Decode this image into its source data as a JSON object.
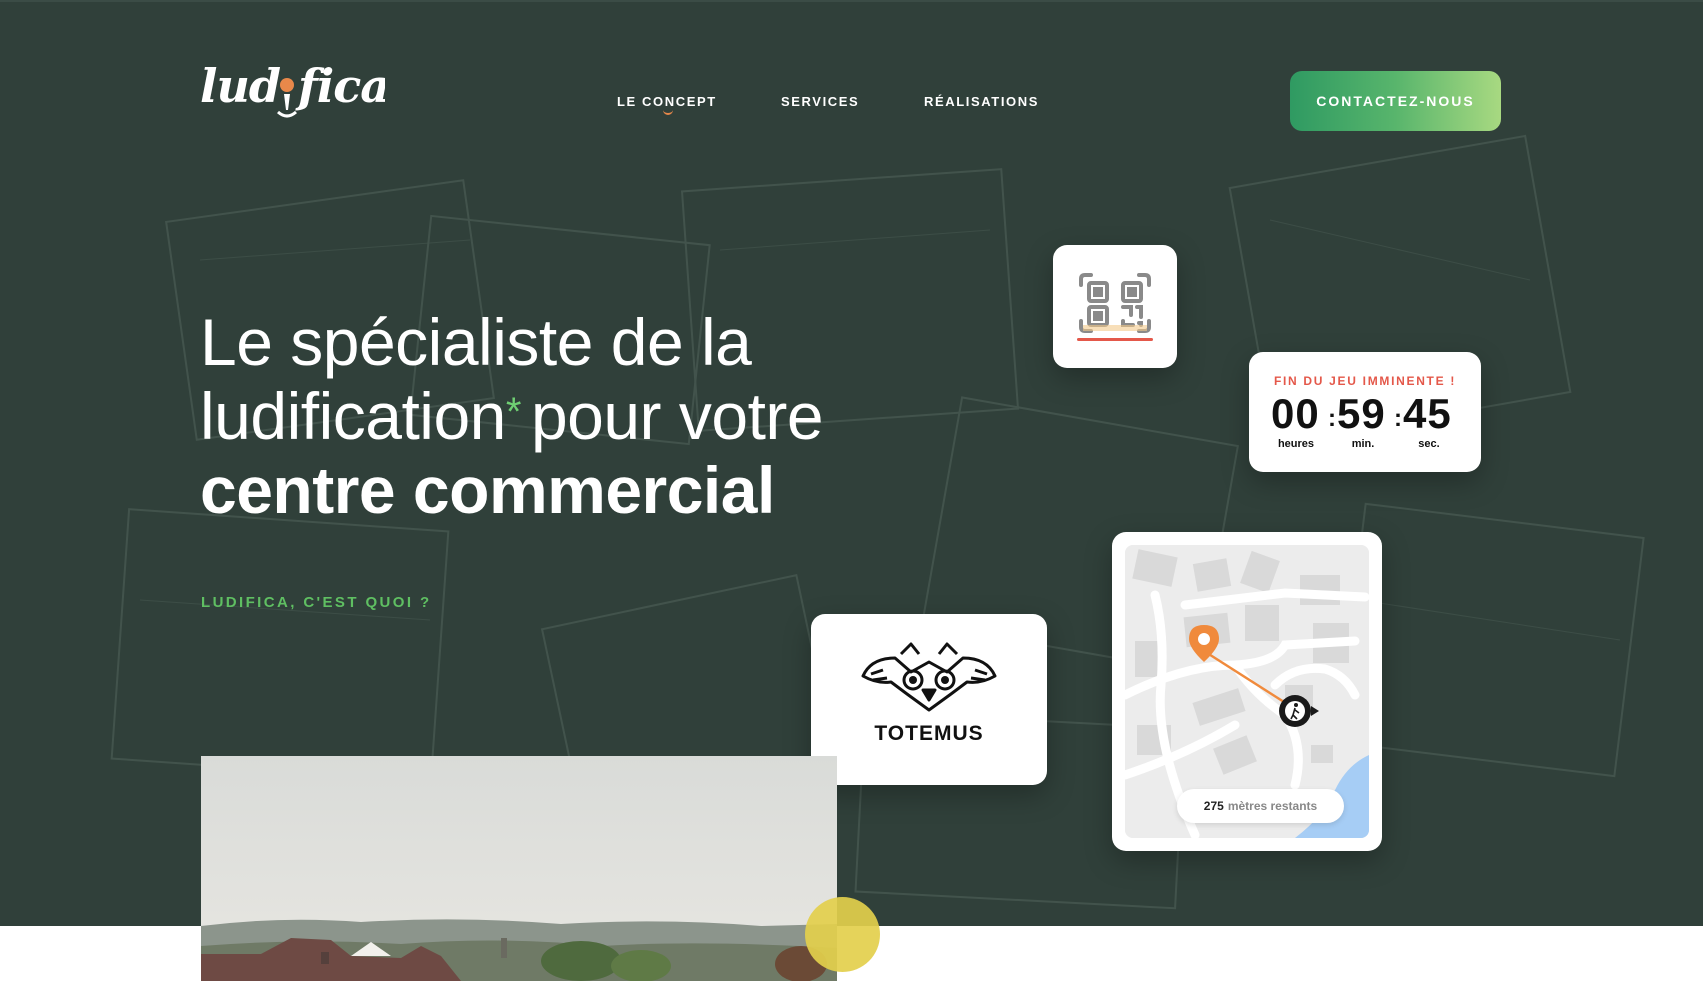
{
  "nav": {
    "logo_text": "ludifica",
    "links": [
      "LE CONCEPT",
      "SERVICES",
      "RÉALISATIONS"
    ],
    "cta_label": "CONTACTEZ-NOUS"
  },
  "hero": {
    "headline_line1": "Le spécialiste de la",
    "headline_line2_word": "ludification",
    "headline_asterisk": "*",
    "headline_line2_rest": "pour votre",
    "headline_line3": "centre commercial",
    "subtitle": "LUDIFICA, C'EST QUOI ?"
  },
  "timer": {
    "title": "FIN DU JEU IMMINENTE !",
    "hours": "00",
    "minutes": "59",
    "seconds": "45",
    "separator": ":",
    "hours_label": "heures",
    "minutes_label": "min.",
    "seconds_label": "sec."
  },
  "totem": {
    "name": "TOTEMUS"
  },
  "map": {
    "distance": "275",
    "distance_label": "mètres restants"
  },
  "colors": {
    "background": "#30403a",
    "accent_green": "#5fbf62",
    "cta_gradient_start": "#2f9a62",
    "cta_gradient_end": "#a8d981",
    "orange": "#e8884a",
    "timer_red": "#e4584a",
    "yellow": "#e3cf4c"
  },
  "icons": [
    "qr-code-icon",
    "map-pin-icon",
    "walker-icon",
    "owl-totem-icon"
  ]
}
